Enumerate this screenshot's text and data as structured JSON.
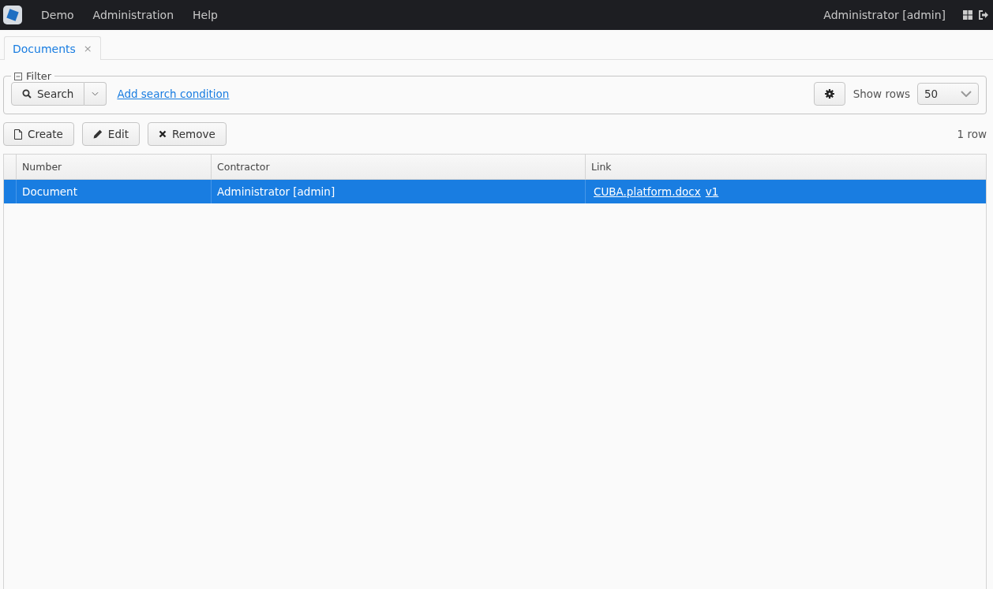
{
  "menu_bar": {
    "items": [
      "Demo",
      "Administration",
      "Help"
    ],
    "user": "Administrator [admin]"
  },
  "tabs": [
    {
      "label": "Documents",
      "close": "×",
      "selected": true
    }
  ],
  "filter": {
    "title": "Filter",
    "expanded": true,
    "search_button": "Search",
    "add_condition": "Add search condition",
    "show_rows_label": "Show rows",
    "show_rows_value": "50"
  },
  "toolbar": {
    "buttons": [
      {
        "kind": "create",
        "label": "Create"
      },
      {
        "kind": "edit",
        "label": "Edit"
      },
      {
        "kind": "remove",
        "label": "Remove"
      }
    ],
    "row_count": "1 row"
  },
  "table": {
    "columns": [
      "Number",
      "Contractor",
      "Link"
    ],
    "rows": [
      {
        "selected": true,
        "number": "Document",
        "contractor": "Administrator [admin]",
        "links": [
          "CUBA.platform.docx",
          "v1"
        ]
      }
    ]
  }
}
